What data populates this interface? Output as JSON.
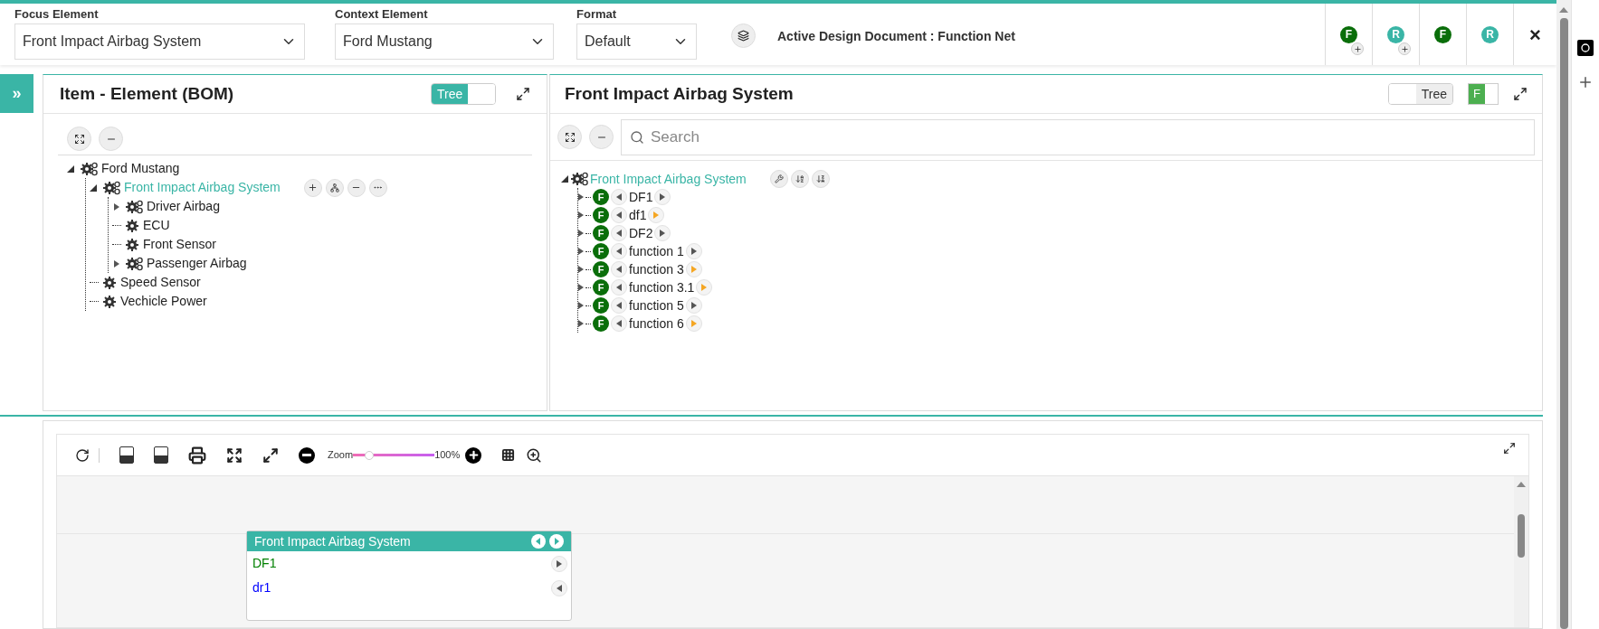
{
  "header": {
    "fields": [
      {
        "label": "Focus Element",
        "value": "Front Impact Airbag System"
      },
      {
        "label": "Context Element",
        "value": "Ford Mustang"
      },
      {
        "label": "Format",
        "value": "Default"
      }
    ],
    "document": "Active Design Document : Function Net",
    "actions": [
      {
        "letter": "F",
        "kind": "function",
        "add": true
      },
      {
        "letter": "R",
        "kind": "requirement",
        "add": true
      },
      {
        "letter": "F",
        "kind": "function",
        "add": false
      },
      {
        "letter": "R",
        "kind": "requirement",
        "add": false
      }
    ],
    "close": "×"
  },
  "sidebar_toggle": "»",
  "bom_panel": {
    "title": "Item - Element (BOM)",
    "tree_toggle": {
      "label": "Tree",
      "on": true
    },
    "tree": [
      {
        "label": "Ford Mustang",
        "kind": "assembly",
        "expanded": true,
        "selected": false,
        "children": [
          {
            "label": "Front Impact Airbag System",
            "kind": "assembly",
            "expanded": true,
            "selected": true,
            "children": [
              {
                "label": "Driver Airbag",
                "kind": "assembly",
                "expanded": false,
                "selected": false
              },
              {
                "label": "ECU",
                "kind": "part",
                "selected": false
              },
              {
                "label": "Front Sensor",
                "kind": "part",
                "selected": false
              },
              {
                "label": "Passenger Airbag",
                "kind": "assembly",
                "expanded": false,
                "selected": false
              }
            ]
          },
          {
            "label": "Speed Sensor",
            "kind": "part",
            "selected": false
          },
          {
            "label": "Vechicle Power",
            "kind": "part",
            "selected": false
          }
        ]
      }
    ]
  },
  "function_panel": {
    "title": "Front Impact Airbag System",
    "tree_toggle": {
      "label": "Tree",
      "on": false
    },
    "badge": "F",
    "search": {
      "placeholder": "Search"
    },
    "root": "Front Impact Airbag System",
    "functions": [
      {
        "badge": "F",
        "label": "DF1",
        "linked": false
      },
      {
        "badge": "F",
        "label": "df1",
        "linked": true
      },
      {
        "badge": "F",
        "label": "DF2",
        "linked": false
      },
      {
        "badge": "F",
        "label": "function 1",
        "linked": false
      },
      {
        "badge": "F",
        "label": "function 3",
        "linked": true
      },
      {
        "badge": "F",
        "label": "function 3.1",
        "linked": true
      },
      {
        "badge": "F",
        "label": "function 5",
        "linked": false
      },
      {
        "badge": "F",
        "label": "function 6",
        "linked": true
      }
    ]
  },
  "diagram": {
    "zoom": {
      "label": "Zoom",
      "level": 0.2,
      "reading": "100%"
    },
    "node": {
      "title": "Front Impact Airbag System",
      "ports": [
        {
          "label": "DF1",
          "kind": "output",
          "color": "#008000"
        },
        {
          "label": "dr1",
          "kind": "input",
          "color": "#0000ff"
        }
      ]
    }
  }
}
